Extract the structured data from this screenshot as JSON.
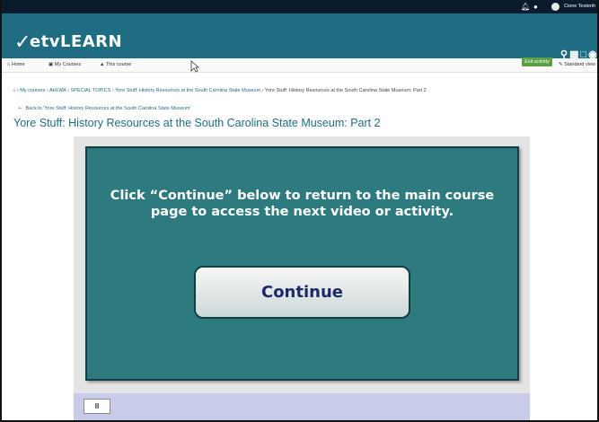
{
  "topbar": {
    "bell_icon": "bell-icon",
    "chat_icon": "chat-icon",
    "user_name": "Cione Testenh"
  },
  "brand": {
    "logo_text": "etvLEARN",
    "social_icons": [
      "search-icon",
      "facebook-icon",
      "twitter-icon",
      "settings-icon"
    ]
  },
  "nav": {
    "items": [
      "Home",
      "My Courses",
      "This course"
    ],
    "exit_label": "Exit activity",
    "standard_view_label": "Standard view"
  },
  "breadcrumb": {
    "items": [
      "My courses",
      "AHLWA",
      "SPECIAL TOPICS",
      "Yore Stuff: History Resources at the South Carolina State Museum",
      "Yore Stuff: History Resources at the South Carolina State Museum: Part 2"
    ]
  },
  "back_link": "Back to 'Yore Stuff: History Resources at the South Carolina State Museum'",
  "page_title": "Yore Stuff: History Resources at the South Carolina State Museum: Part 2",
  "slide": {
    "message_line1": "Click “Continue” below to return to the main course",
    "message_line2": "page to access the next video or activity.",
    "button_label": "Continue",
    "background_color": "#2d7b7f"
  },
  "player": {
    "pause_label": "II"
  },
  "colors": {
    "brand": "#1e6d82",
    "topbar": "#0b1b2e",
    "exit_button": "#5aa144"
  }
}
